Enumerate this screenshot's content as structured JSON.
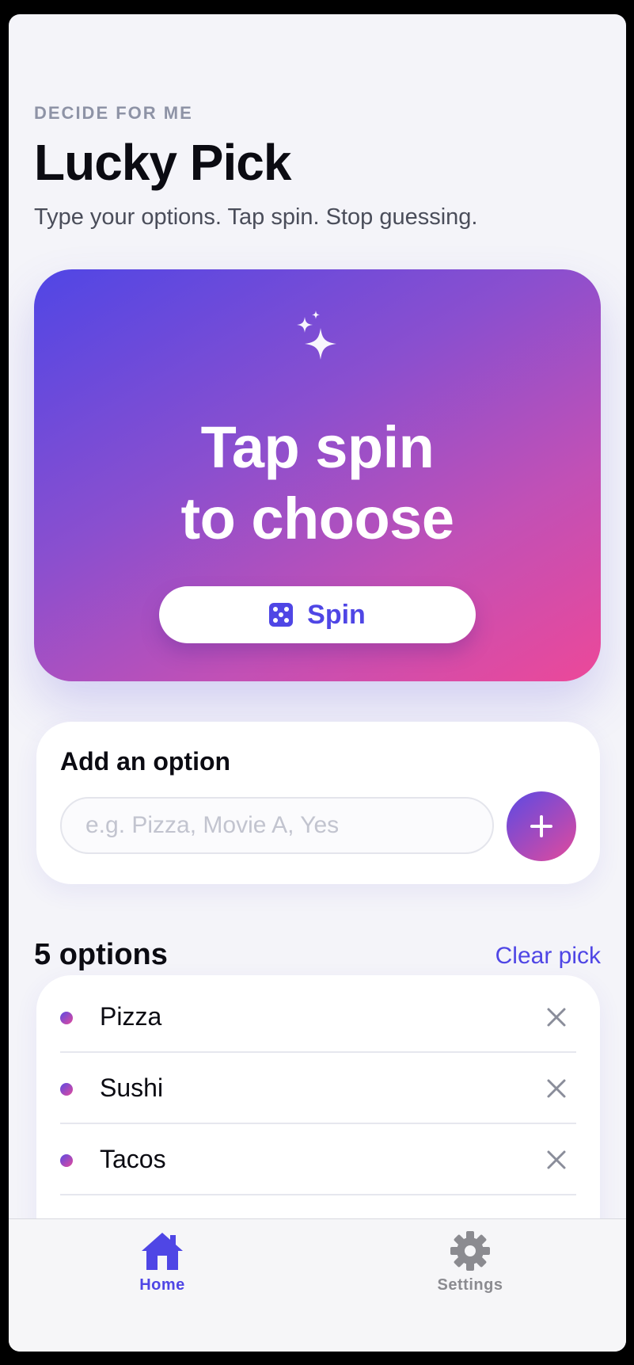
{
  "header": {
    "eyebrow": "DECIDE FOR ME",
    "title": "Lucky Pick",
    "subtitle": "Type your options. Tap spin. Stop guessing."
  },
  "hero": {
    "icon": "sparkles-icon",
    "line1": "Tap spin",
    "line2": "to choose",
    "spin_icon": "dice-icon",
    "spin_label": "Spin",
    "gradient": [
      "#5046e5",
      "#ec4899"
    ]
  },
  "add_option": {
    "title": "Add an option",
    "placeholder": "e.g. Pizza, Movie A, Yes",
    "value": "",
    "add_icon": "plus-icon"
  },
  "options": {
    "count_label": "5 options",
    "clear_label": "Clear pick",
    "items": [
      {
        "label": "Pizza"
      },
      {
        "label": "Sushi"
      },
      {
        "label": "Tacos"
      }
    ],
    "remove_icon": "close-icon"
  },
  "tabbar": {
    "home_label": "Home",
    "settings_label": "Settings",
    "active": "Home"
  },
  "colors": {
    "accent": "#4f46e5",
    "background": "#f4f4f9"
  }
}
